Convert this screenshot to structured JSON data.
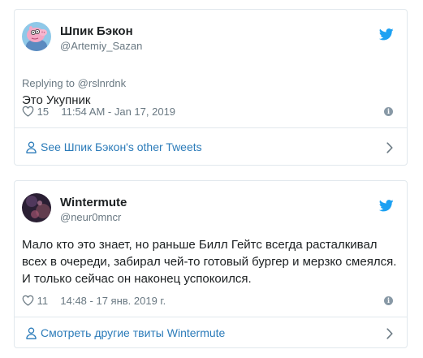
{
  "colors": {
    "link": "#2b7bb9",
    "muted": "#697882",
    "text": "#1c2022",
    "border": "#e1e8ed",
    "twitter_blue": "#1da1f2"
  },
  "tweets": [
    {
      "author_name": "Шпик Бэкон",
      "author_handle": "@Artemiy_Sazan",
      "avatar_icon": "peppa-pig-avatar",
      "reply_prefix": "Replying to",
      "reply_handle": "@rslnrdnk",
      "text": "Это Укупник",
      "likes": "15",
      "timestamp": "11:54 AM - Jan 17, 2019",
      "footer_label": "See Шпик Бэкон's other Tweets"
    },
    {
      "author_name": "Wintermute",
      "author_handle": "@neur0mncr",
      "avatar_icon": "dark-photo-avatar",
      "text": "Мало кто это знает, но раньше Билл Гейтс всегда расталкивал всех в очереди, забирал чей-то готовый бургер и мерзко смеялся. И только сейчас он наконец успокоился.",
      "likes": "11",
      "timestamp": "14:48 - 17 янв. 2019 г.",
      "footer_label": "Смотреть другие твиты Wintermute"
    }
  ]
}
